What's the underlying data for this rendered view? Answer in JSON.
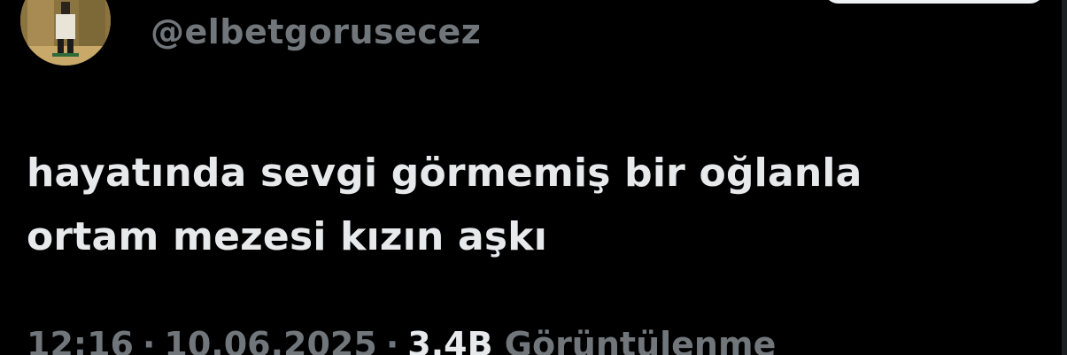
{
  "tweet": {
    "handle": "@elbetgorusecez",
    "text_lines": [
      "hayatında sevgi görmemiş bir oğlanla",
      "ortam mezesi kızın aşkı"
    ],
    "time": "12:16",
    "date": "10.06.2025",
    "views_count": "3,4B",
    "views_label": "Görüntülenme",
    "separator": "·"
  },
  "icons": {
    "avatar": "profile-avatar-photo"
  },
  "colors": {
    "background": "#000000",
    "primary_text": "#e7e9ea",
    "secondary_text": "#71767b"
  }
}
